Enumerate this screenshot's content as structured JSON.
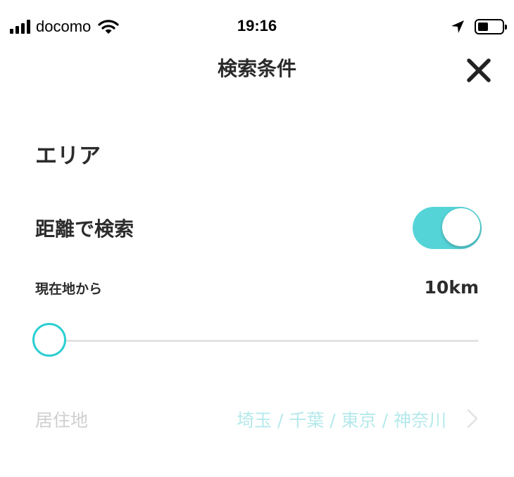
{
  "status_bar": {
    "carrier": "docomo",
    "time": "19:16",
    "battery_level": 0.45
  },
  "header": {
    "title": "検索条件",
    "close_icon": "close-icon"
  },
  "area": {
    "section_title": "エリア",
    "distance_search": {
      "label": "距離で検索",
      "enabled": true
    },
    "distance": {
      "label": "現在地から",
      "value_text": "10km",
      "slider_fraction": 0
    },
    "residence": {
      "label": "居住地",
      "value": "埼玉 / 千葉 / 東京 / 神奈川",
      "chevron_icon": "chevron-right-icon"
    }
  },
  "colors": {
    "accent": "#2ccfd3",
    "toggle_on": "#55d4d8",
    "disabled_text": "#cfcfcf",
    "disabled_accent": "#b5e9eb"
  }
}
